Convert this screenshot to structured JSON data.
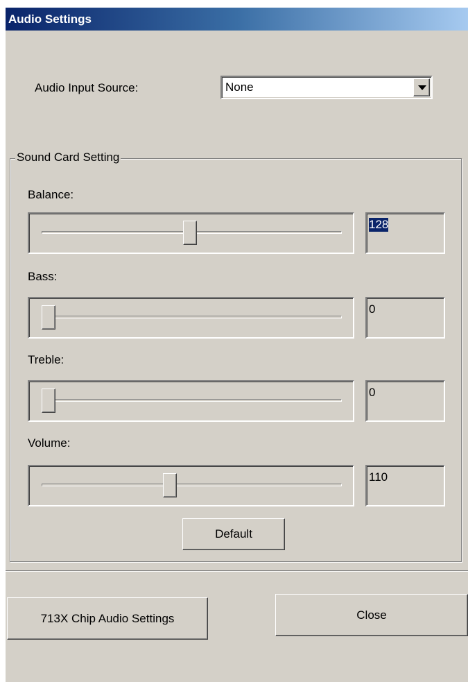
{
  "window": {
    "title": "Audio Settings"
  },
  "input_source": {
    "label": "Audio Input Source:",
    "selected": "None"
  },
  "sound_card": {
    "group_label": "Sound Card Setting",
    "sliders": [
      {
        "label": "Balance:",
        "value": "128",
        "position": 0.5
      },
      {
        "label": "Bass:",
        "value": "0",
        "position": 0.0
      },
      {
        "label": "Treble:",
        "value": "0",
        "position": 0.0
      },
      {
        "label": "Volume:",
        "value": "110",
        "position": 0.43
      }
    ],
    "default_label": "Default"
  },
  "footer": {
    "chip_settings_label": "713X Chip  Audio Settings",
    "close_label": "Close"
  }
}
